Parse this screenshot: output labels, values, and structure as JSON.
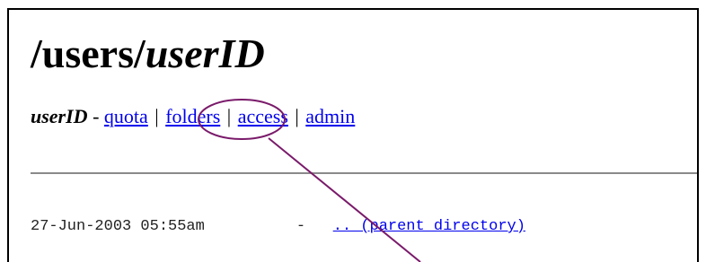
{
  "page": {
    "title_prefix": "/users/",
    "title_italic": "userID"
  },
  "nav": {
    "user_label": "userID",
    "dash": " - ",
    "links": [
      {
        "label": "quota"
      },
      {
        "label": "folders"
      },
      {
        "label": "access"
      },
      {
        "label": "admin"
      }
    ],
    "separator": "|"
  },
  "listing": {
    "rows": [
      {
        "date": "27-Jun-2003 05:55am",
        "size": "-",
        "link_label": ".. (parent directory)"
      }
    ]
  },
  "annotation": {
    "color": "#7a1a6a",
    "target": "folders"
  }
}
